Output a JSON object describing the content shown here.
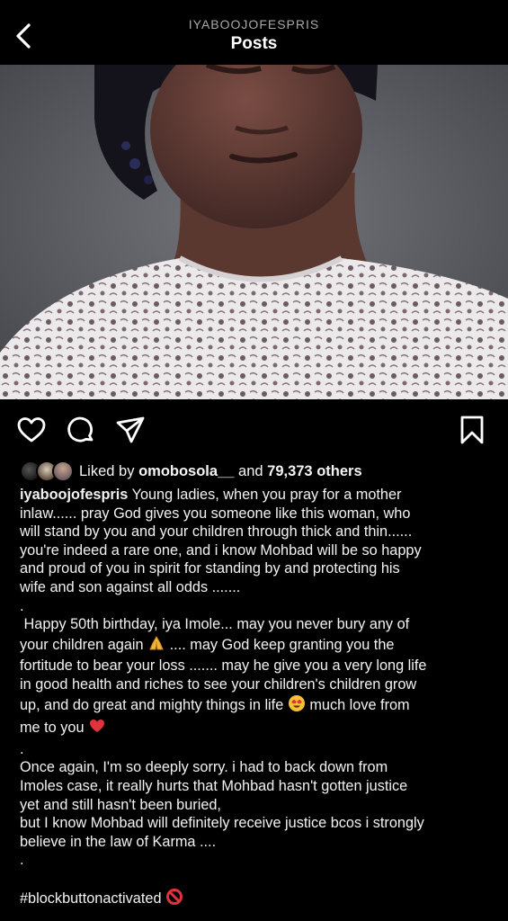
{
  "header": {
    "username": "IYABOOJOFESPRIS",
    "title": "Posts"
  },
  "icons": {
    "back": "chevron-left-icon",
    "mute": "muted-speaker-icon",
    "like": "heart-icon",
    "comment": "comment-bubble-icon",
    "share": "paper-plane-icon",
    "save": "bookmark-icon"
  },
  "likes": {
    "prefix": "Liked by",
    "user": "omobosola__",
    "middle": "and",
    "others": "79,373 others"
  },
  "caption": {
    "username": "iyaboojofespris",
    "line_1": "Young ladies, when you pray for a mother",
    "line_2": "inlaw...... pray God gives you someone like this woman, who",
    "line_3": "will stand by you and your children through thick and thin......",
    "line_4": "you're indeed a rare one, and i know Mohbad will be so happy",
    "line_5": "and proud of you in spirit for standing by and protecting his",
    "line_6": "wife and son against all odds .......",
    "line_7": ".",
    "line_8": " Happy 50th birthday, iya Imole... may you never bury any of",
    "line_9a": "your children again",
    "line_9b": ".... may God keep granting you the",
    "line_10": "fortitude to bear your loss ....... may he give you a very long life",
    "line_11": "in good health and riches to see your children's children grow",
    "line_12a": "up, and do great and mighty things in life",
    "line_12b": "much love from",
    "line_13": "me to you",
    "line_14": ".",
    "line_15": "Once again, I'm so deeply sorry. i had to back down from",
    "line_16": "Imoles case, it really hurts that Mohbad hasn't gotten justice",
    "line_17": "yet and still hasn't been buried,",
    "line_18": "but I know Mohbad will definitely receive justice bcos i strongly",
    "line_19": "believe in the law of Karma ....",
    "line_20": ".",
    "hashtag": "#blockbuttonactivated"
  },
  "colors": {
    "background": "#000000",
    "text": "#f5f5f5",
    "muted_text": "#a8a8a8",
    "heart_emoji": "#e0333c",
    "prohibited_emoji": "#e0333c"
  }
}
